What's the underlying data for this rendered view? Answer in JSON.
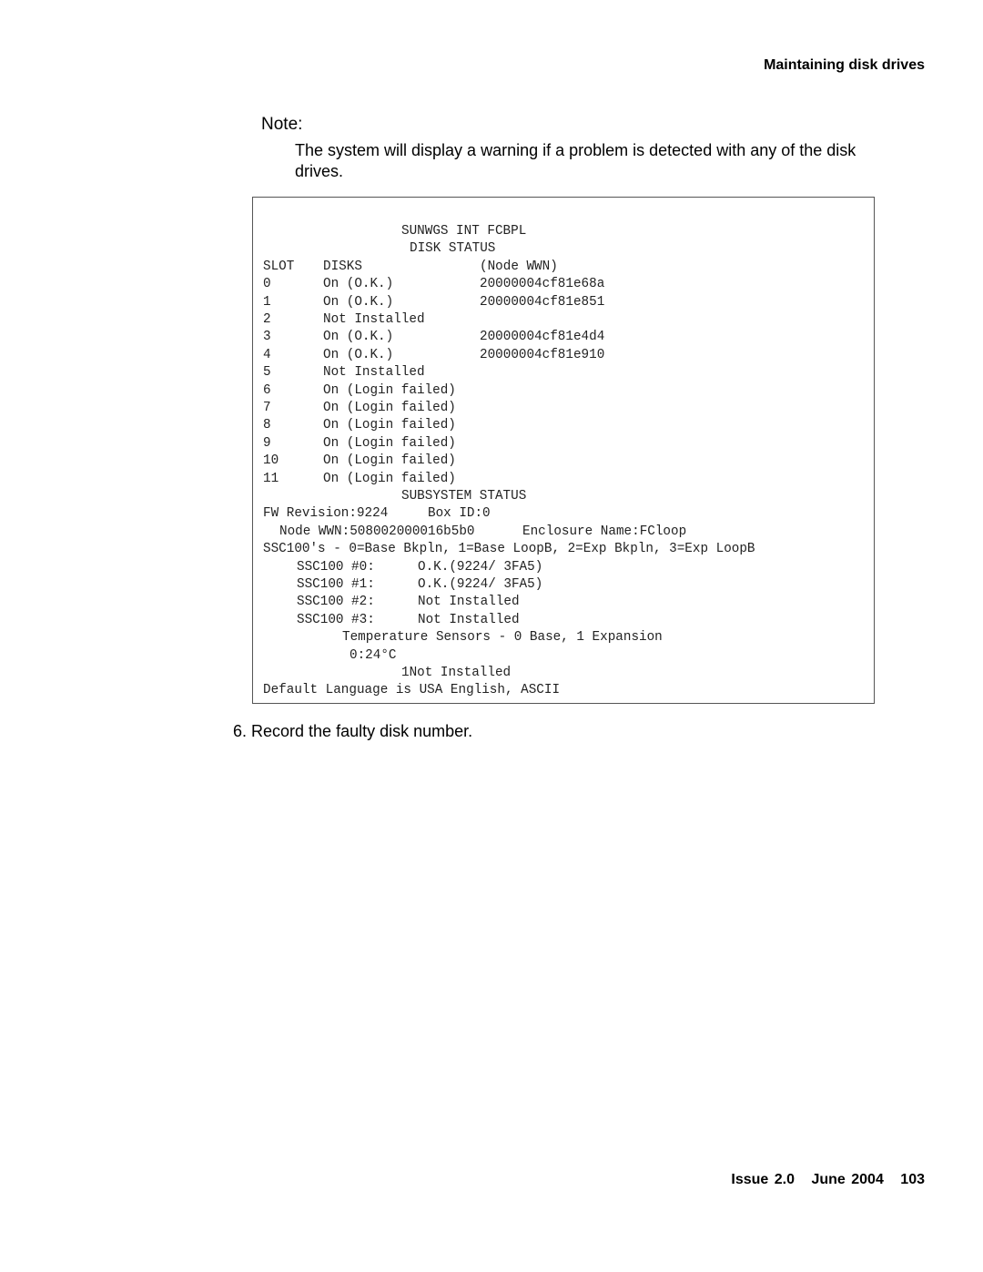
{
  "header": {
    "section_title": "Maintaining disk drives"
  },
  "note": {
    "label": "Note:",
    "text": "The system will display a warning if a problem is detected with any of the disk drives."
  },
  "console": {
    "title": "SUNWGS INT FCBPL",
    "disk_status_heading": "DISK STATUS",
    "columns": {
      "slot": "SLOT",
      "disks": "DISKS",
      "wwn": "(Node WWN)"
    },
    "rows": [
      {
        "slot": "0",
        "status": "On (O.K.)",
        "wwn": "20000004cf81e68a"
      },
      {
        "slot": "1",
        "status": "On (O.K.)",
        "wwn": "20000004cf81e851"
      },
      {
        "slot": "2",
        "status": "Not Installed",
        "wwn": ""
      },
      {
        "slot": "3",
        "status": "On (O.K.)",
        "wwn": "20000004cf81e4d4"
      },
      {
        "slot": "4",
        "status": "On (O.K.)",
        "wwn": "20000004cf81e910"
      },
      {
        "slot": "5",
        "status": "Not Installed",
        "wwn": ""
      },
      {
        "slot": "6",
        "status": "On (Login failed)",
        "wwn": ""
      },
      {
        "slot": "7",
        "status": "On (Login failed)",
        "wwn": ""
      },
      {
        "slot": "8",
        "status": "On (Login failed)",
        "wwn": ""
      },
      {
        "slot": "9",
        "status": "On (Login failed)",
        "wwn": ""
      },
      {
        "slot": "10",
        "status": "On (Login failed)",
        "wwn": ""
      },
      {
        "slot": "11",
        "status": "On (Login failed)",
        "wwn": ""
      }
    ],
    "subsystem_heading": "SUBSYSTEM STATUS",
    "fw_revision": "FW Revision:9224",
    "box_id": "Box ID:0",
    "node_wwn": "Node WWN:508002000016b5b0",
    "enclosure_name": "Enclosure Name:FCloop",
    "ssc_legend": "SSC100's - 0=Base Bkpln, 1=Base LoopB, 2=Exp Bkpln, 3=Exp LoopB",
    "ssc": [
      {
        "label": "SSC100 #0:",
        "status": "O.K.(9224/ 3FA5)"
      },
      {
        "label": "SSC100 #1:",
        "status": "O.K.(9224/ 3FA5)"
      },
      {
        "label": "SSC100 #2:",
        "status": "Not Installed"
      },
      {
        "label": "SSC100 #3:",
        "status": "Not Installed"
      }
    ],
    "temp_heading": "Temperature Sensors - 0 Base, 1 Expansion",
    "temp_0": "0:24°C",
    "temp_1": "1Not Installed",
    "language": "Default Language is USA English, ASCII"
  },
  "step": {
    "text": "6. Record the faulty disk number."
  },
  "footer": {
    "issue": "Issue 2.0",
    "date": "June 2004",
    "page": "103"
  }
}
